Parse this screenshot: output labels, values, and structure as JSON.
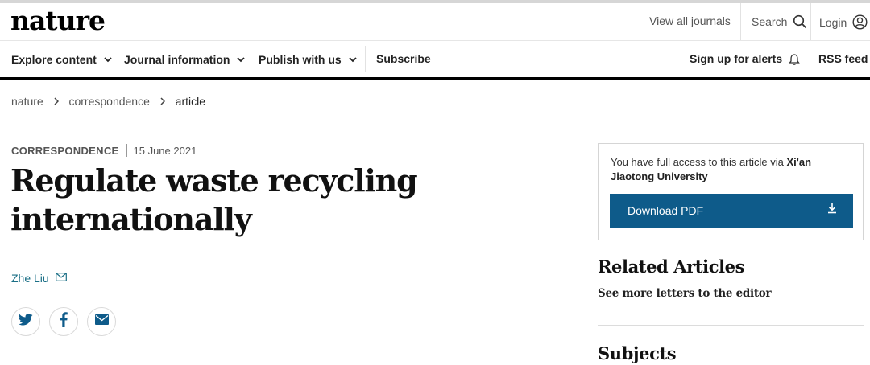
{
  "header": {
    "logo": "nature",
    "view_all_journals": "View all journals",
    "search_label": "Search",
    "login_label": "Login"
  },
  "nav": {
    "explore": "Explore content",
    "journal_info": "Journal information",
    "publish": "Publish with us",
    "subscribe": "Subscribe",
    "alerts": "Sign up for alerts",
    "rss": "RSS feed"
  },
  "breadcrumb": [
    "nature",
    "correspondence",
    "article"
  ],
  "article": {
    "type": "CORRESPONDENCE",
    "date": "15 June 2021",
    "title": "Regulate waste recycling internationally",
    "author": "Zhe Liu"
  },
  "share": {
    "icons": [
      "twitter-icon",
      "facebook-icon",
      "email-icon"
    ]
  },
  "access": {
    "text_prefix": "You have full access to this article via ",
    "institution": "Xi'an Jiaotong University",
    "download_label": "Download PDF"
  },
  "sidebar": {
    "related_heading": "Related Articles",
    "see_more": "See more letters to the editor",
    "subjects_heading": "Subjects"
  },
  "colors": {
    "accent_blue": "#0e5b8a",
    "author_link": "#1b6f86",
    "rule_black": "#000000"
  }
}
